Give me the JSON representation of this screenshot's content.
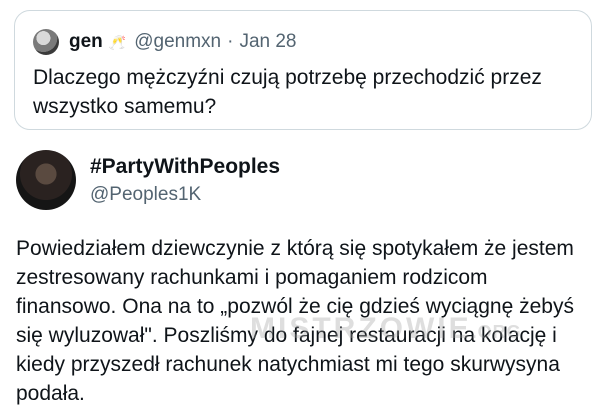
{
  "quote": {
    "name": "gen",
    "emoji": "🥂",
    "handle": "@genmxn",
    "separator": "·",
    "date": "Jan 28",
    "text": "Dlaczego mężczyźni czują potrzebę przechodzić przez wszystko samemu?"
  },
  "post": {
    "display_name": "#PartyWithPeoples",
    "handle": "@Peoples1K",
    "text": "Powiedziałem dziewczynie z którą się spotykałem że jestem zestresowany rachunkami i pomaganiem rodzicom finansowo. Ona na to „pozwól że cię gdzieś wyciągnę żebyś się wyluzował\". Poszliśmy do fajnej restauracji na kolację i kiedy przyszedł rachunek natychmiast mi tego skurwysyna podała."
  },
  "watermark": {
    "main": "MISTRZOWIE",
    "tld": ".ORG"
  }
}
